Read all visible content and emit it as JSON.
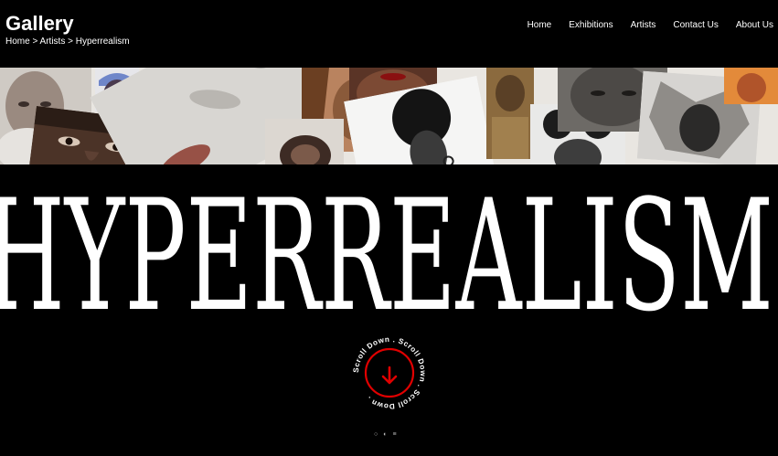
{
  "header": {
    "brand": "Gallery",
    "breadcrumb": [
      "Home",
      "Artists",
      "Hyperrealism"
    ],
    "breadcrumb_sep": " > "
  },
  "nav": {
    "items": [
      "Home",
      "Exhibitions",
      "Artists",
      "Contact Us",
      "About Us"
    ]
  },
  "collage": {
    "tiles": [
      "artwork-bald-bearded-man",
      "artwork-man-eyes-closeup",
      "artwork-man-blue-cap",
      "artwork-larva-and-rice",
      "artwork-woman-locs",
      "artwork-woman-red-lips",
      "artwork-afro-portrait",
      "artwork-man-gold-tones",
      "artwork-girl-puffs",
      "artwork-elder-closeup",
      "artwork-figure-crumpled-paper",
      "artwork-woman-orange"
    ]
  },
  "hero": {
    "title": "HYPERREALISM"
  },
  "scroll": {
    "ring_text": "Scroll Down . Scroll Down . Scroll Down . ",
    "accent": "#e10000"
  },
  "mini_icons": [
    "chat-icon",
    "eye-icon",
    "menu-icon"
  ]
}
